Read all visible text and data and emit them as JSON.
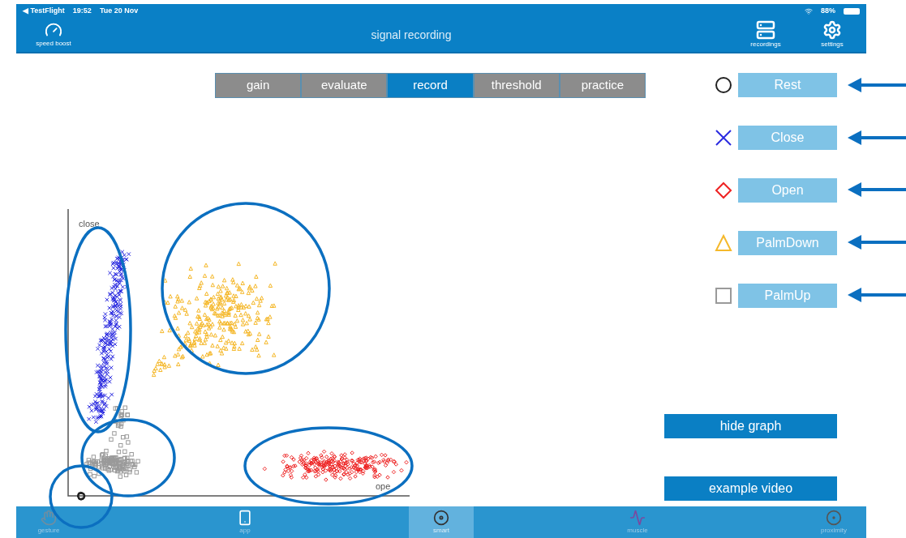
{
  "status_bar": {
    "back": "◀ TestFlight",
    "time": "19:52",
    "date": "Tue 20 Nov",
    "battery": "88%"
  },
  "header": {
    "title": "signal recording",
    "left": {
      "label": "speed boost"
    },
    "right": [
      {
        "kind": "recordings",
        "label": "recordings"
      },
      {
        "kind": "settings",
        "label": "settings"
      }
    ]
  },
  "tabs": [
    {
      "label": "gain",
      "selected": false
    },
    {
      "label": "evaluate",
      "selected": false
    },
    {
      "label": "record",
      "selected": true
    },
    {
      "label": "threshold",
      "selected": false
    },
    {
      "label": "practice",
      "selected": false
    }
  ],
  "legend": [
    {
      "kind": "circle",
      "label": "Rest",
      "color": "#222222"
    },
    {
      "kind": "cross",
      "label": "Close",
      "color": "#2a2ae0"
    },
    {
      "kind": "diamond",
      "label": "Open",
      "color": "#ee2222"
    },
    {
      "kind": "triangle",
      "label": "PalmDown",
      "color": "#f5b82a"
    },
    {
      "kind": "square",
      "label": "PalmUp",
      "color": "#9a9a9a"
    }
  ],
  "plot": {
    "y_label": "close",
    "x_label": "ope"
  },
  "actions": [
    "hide graph",
    "example video"
  ],
  "nav": [
    {
      "kind": "gesture",
      "label": "gesture",
      "selected": false
    },
    {
      "kind": "app",
      "label": "app",
      "selected": false
    },
    {
      "kind": "smart",
      "label": "smart",
      "selected": true
    },
    {
      "kind": "muscle",
      "label": "muscle",
      "selected": false
    },
    {
      "kind": "proximity",
      "label": "proximity",
      "selected": false
    }
  ]
}
